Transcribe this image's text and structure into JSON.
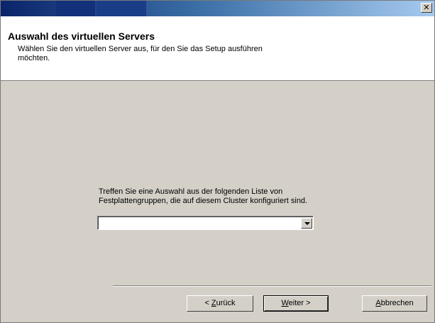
{
  "window": {
    "close_glyph": "✕"
  },
  "header": {
    "title": "Auswahl des virtuellen Servers",
    "subtitle": "Wählen Sie den virtuellen Server aus, für den Sie das Setup ausführen möchten."
  },
  "main": {
    "instruction": "Treffen Sie eine Auswahl aus der folgenden Liste von Festplattengruppen, die auf diesem Cluster konfiguriert sind.",
    "combo_value": ""
  },
  "buttons": {
    "back": {
      "prefix": "< ",
      "mnemonic": "Z",
      "rest": "urück"
    },
    "next": {
      "mnemonic": "W",
      "rest": "eiter >"
    },
    "cancel": {
      "mnemonic": "A",
      "rest": "bbrechen"
    }
  },
  "colors": {
    "titlebar_start": "#0a246a",
    "titlebar_end": "#a6caf0",
    "dialog_face": "#d4d0c8",
    "header_bg": "#ffffff"
  },
  "icons": {
    "close": "close-icon",
    "dropdown": "chevron-down-icon"
  }
}
